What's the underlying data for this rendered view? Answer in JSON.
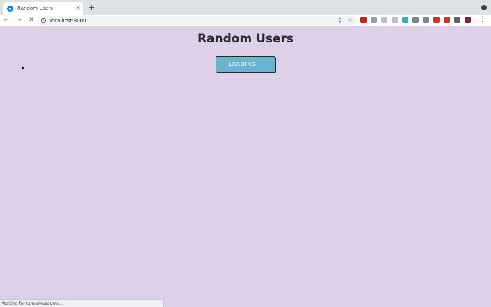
{
  "browser": {
    "tab": {
      "title": "Random Users",
      "close_glyph": "×"
    },
    "new_tab_glyph": "+",
    "url": "localhost:3000",
    "nav": {
      "back": "←",
      "forward": "→",
      "stop": "✕"
    },
    "omnibox_icons": [
      "zoom-icon",
      "star-icon"
    ],
    "extensions": [
      {
        "name": "extension-red-icon",
        "color": "#c5221f"
      },
      {
        "name": "extension-gray-icon",
        "color": "#9aa0a6"
      },
      {
        "name": "extension-gray2-icon",
        "color": "#bdc1c6"
      },
      {
        "name": "extension-gray3-icon",
        "color": "#bdc1c6"
      },
      {
        "name": "extension-teal-icon",
        "color": "#3aa9c1"
      },
      {
        "name": "extension-face-icon",
        "color": "#80868b"
      },
      {
        "name": "extension-check-icon",
        "color": "#80868b"
      },
      {
        "name": "extension-badge-icon",
        "color": "#d93025"
      },
      {
        "name": "extension-flag-icon",
        "color": "#d93025"
      },
      {
        "name": "extensions-puzzle-icon",
        "color": "#5f6368"
      },
      {
        "name": "profile-avatar-icon",
        "color": "#7a2c2c"
      }
    ],
    "status": "Waiting for randomuser.me..."
  },
  "page": {
    "title": "Random Users",
    "button_label": "LOADING..."
  },
  "colors": {
    "page_background": "#ddd0e8",
    "button_background": "#6ab4cf"
  }
}
